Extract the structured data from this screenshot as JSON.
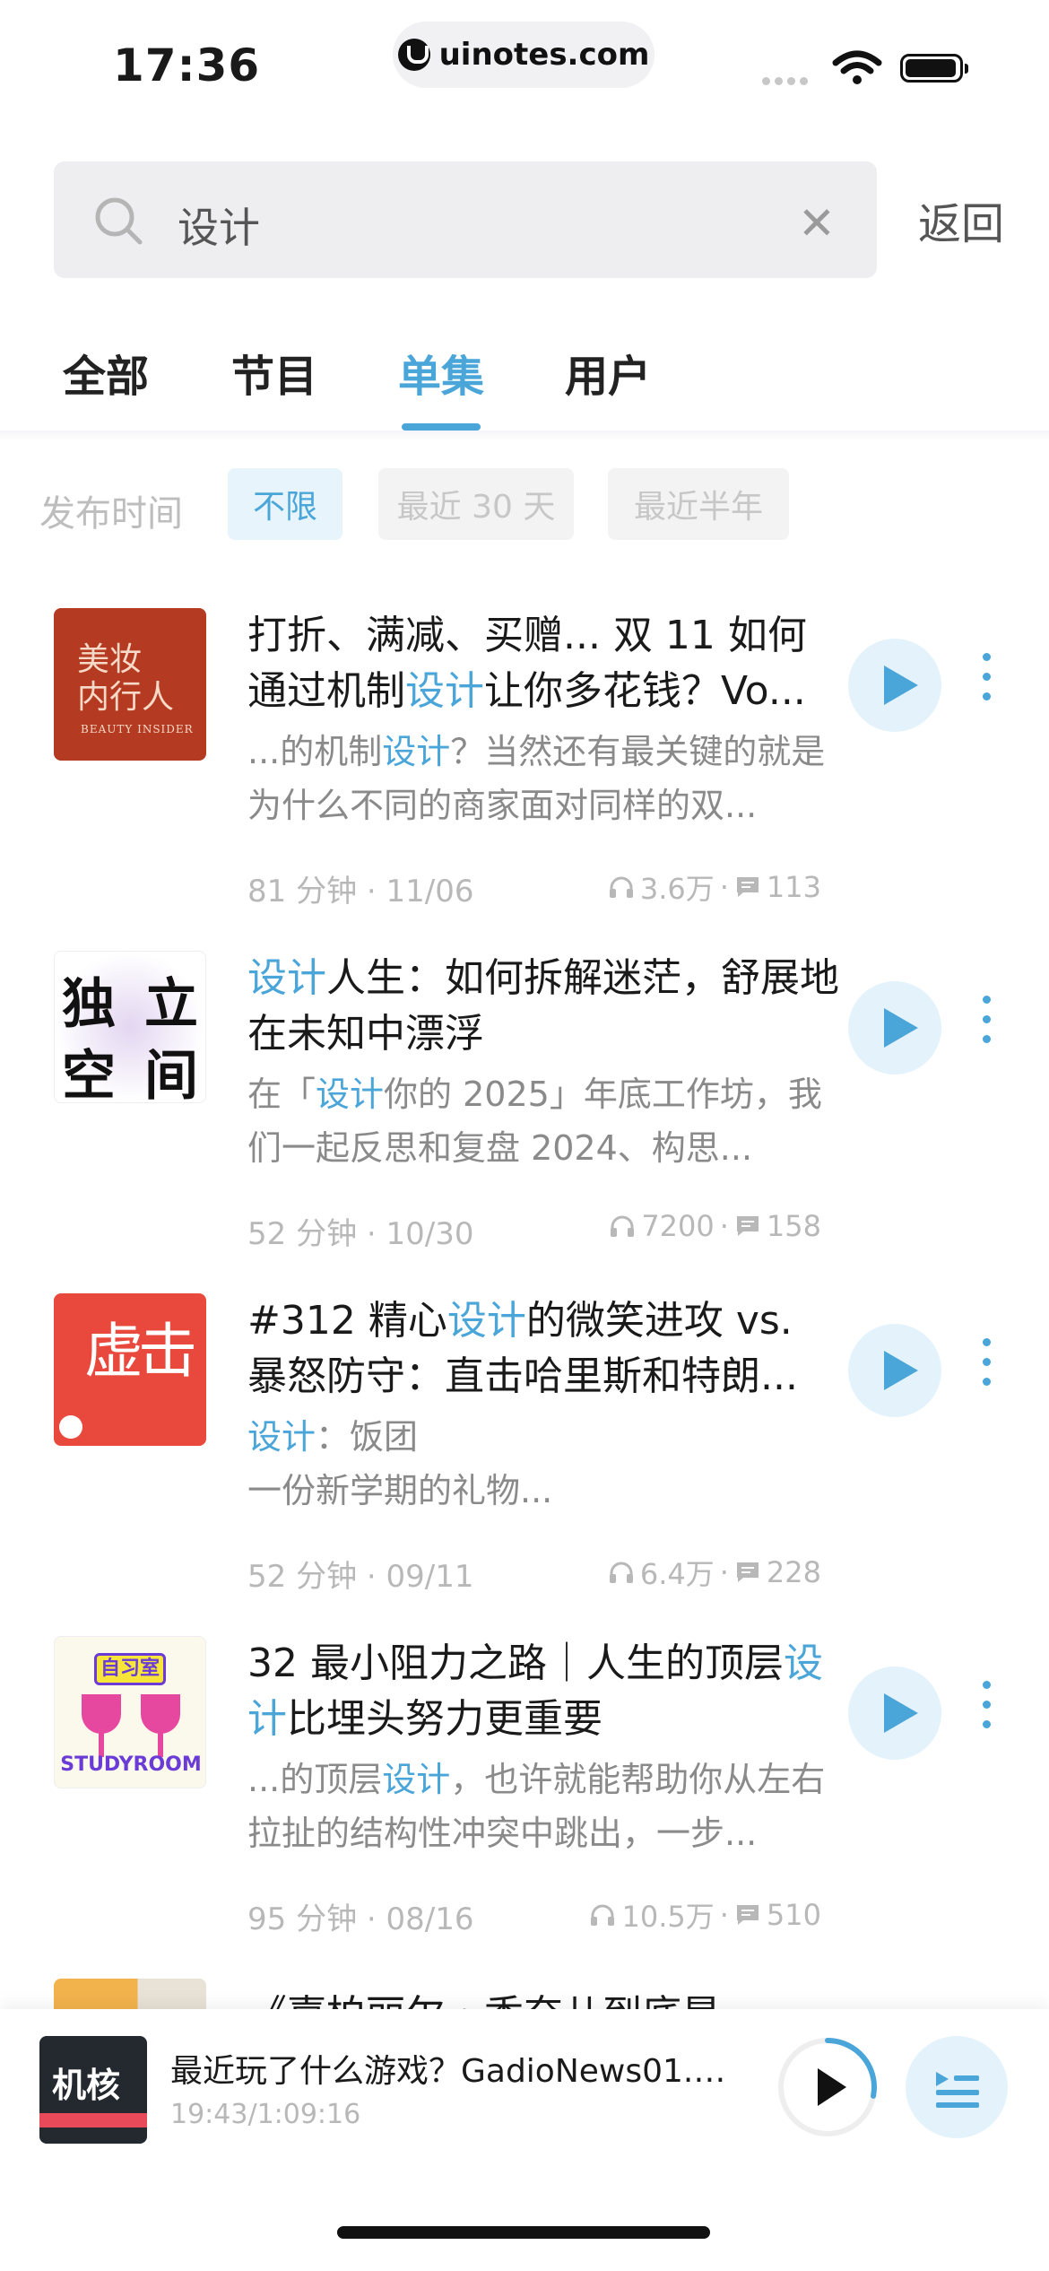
{
  "status_bar": {
    "time": "17:36",
    "url": "uinotes.com"
  },
  "search": {
    "query": "设计",
    "back_label": "返回"
  },
  "tabs": [
    {
      "label": "全部",
      "active": false
    },
    {
      "label": "节目",
      "active": false
    },
    {
      "label": "单集",
      "active": true
    },
    {
      "label": "用户",
      "active": false
    }
  ],
  "filter": {
    "label": "发布时间",
    "options": [
      "不限",
      "最近 30 天",
      "最近半年"
    ],
    "selected": "不限"
  },
  "episodes": [
    {
      "title_pre": "打折、满减、买赠... 双 11 如何通过机制",
      "title_hl": "设计",
      "title_post": "让你多花钱？Vo...",
      "desc_pre": "...的机制",
      "desc_hl": "设计",
      "desc_post": "？当然还有最关键的就是为什么不同的商家面对同样的双...",
      "duration": "81 分钟",
      "date": "11/06",
      "plays": "3.6万",
      "comments": "113",
      "cover_text": {
        "line1": "美妆",
        "line2": "内行人",
        "line3": "BEAUTY INSIDER"
      }
    },
    {
      "title_pre": "",
      "title_hl": "设计",
      "title_post": "人生：如何拆解迷茫，舒展地在未知中漂浮",
      "desc_pre": "在「",
      "desc_hl": "设计",
      "desc_post": "你的 2025」年底工作坊，我们一起反思和复盘 2024、构思...",
      "duration": "52 分钟",
      "date": "10/30",
      "plays": "7200",
      "comments": "158",
      "cover_text": {
        "c1": "独",
        "c2": "立",
        "c3": "空",
        "c4": "间"
      }
    },
    {
      "title_pre": "#312 精心",
      "title_hl": "设计",
      "title_post": "的微笑进攻 vs. 暴怒防守：直击哈里斯和特朗...",
      "desc_pre": "",
      "desc_hl": "设计",
      "desc_post": "：饭团",
      "desc_line2": "一份新学期的礼物...",
      "duration": "52 分钟",
      "date": "09/11",
      "plays": "6.4万",
      "comments": "228",
      "cover_text": {
        "glyph": "虚击"
      }
    },
    {
      "title_pre": "32 最小阻力之路｜人生的顶层",
      "title_hl": "设计",
      "title_post": "比埋头努力更重要",
      "desc_pre": "...的顶层",
      "desc_hl": "设计",
      "desc_post": "，也许就能帮助你从左右拉扯的结构性冲突中跳出，一步...",
      "duration": "95 分钟",
      "date": "08/16",
      "plays": "10.5万",
      "comments": "510",
      "cover_text": {
        "badge": "自习室",
        "label": "STUDYROOM"
      }
    }
  ],
  "partial_item": {
    "title": "《嘉柏丽尔・香奈儿到底是"
  },
  "player": {
    "title": "最近玩了什么游戏？GadioNews01.0...",
    "time": "19:43/1:09:16",
    "cover_text": "机核",
    "progress": 0.28
  },
  "colors": {
    "accent": "#4aa5d9",
    "accent_bg": "#e4f3fb"
  }
}
